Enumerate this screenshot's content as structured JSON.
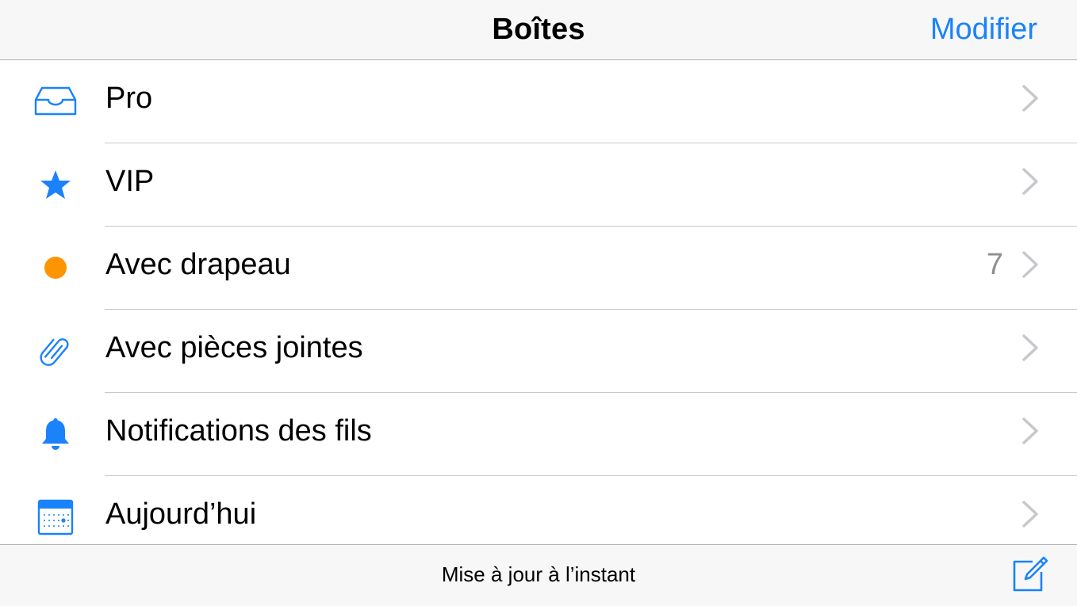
{
  "navbar": {
    "title": "Boîtes",
    "edit_label": "Modifier"
  },
  "colors": {
    "accent": "#1a82fb",
    "flag": "#fd9500",
    "count": "#8e8e93",
    "chevron": "#c7c7cc"
  },
  "mailboxes": [
    {
      "label": "Pro",
      "icon": "inbox-tray-icon",
      "count": ""
    },
    {
      "label": "VIP",
      "icon": "star-icon",
      "count": ""
    },
    {
      "label": "Avec drapeau",
      "icon": "flag-dot-icon",
      "count": "7"
    },
    {
      "label": "Avec pièces jointes",
      "icon": "paperclip-icon",
      "count": ""
    },
    {
      "label": "Notifications des fils",
      "icon": "bell-icon",
      "count": ""
    },
    {
      "label": "Aujourd’hui",
      "icon": "calendar-icon",
      "count": ""
    }
  ],
  "toolbar": {
    "status_text": "Mise à jour à l’instant",
    "compose_icon": "compose-icon"
  }
}
